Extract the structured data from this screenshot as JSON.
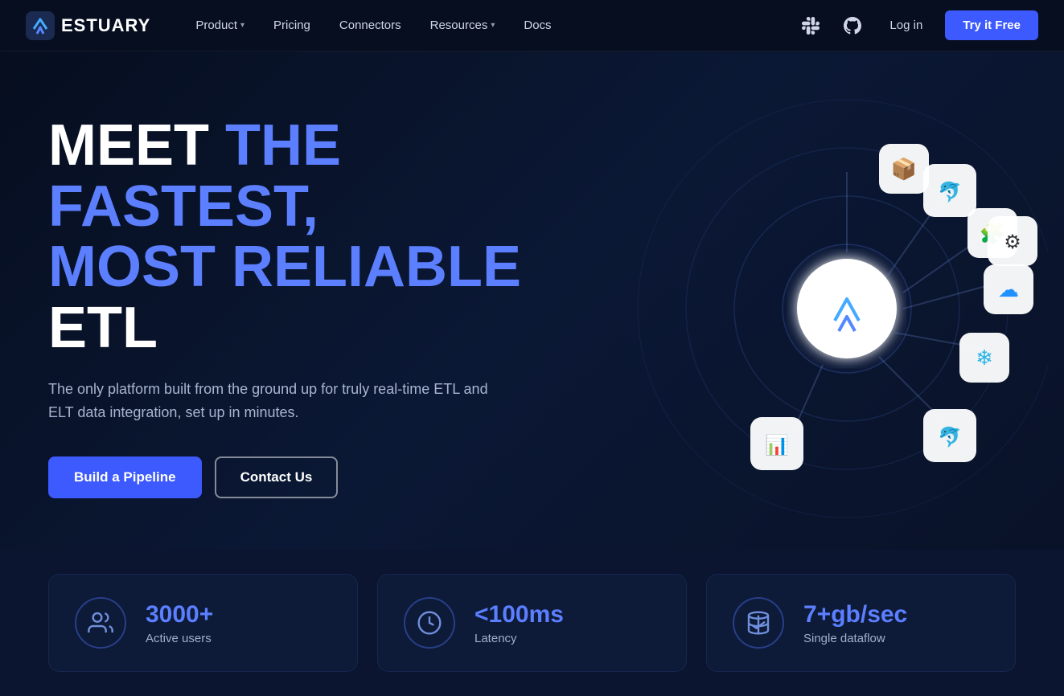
{
  "logo": {
    "text": "ESTUARY"
  },
  "nav": {
    "links": [
      {
        "label": "Product",
        "hasDropdown": true,
        "id": "product"
      },
      {
        "label": "Pricing",
        "hasDropdown": false,
        "id": "pricing"
      },
      {
        "label": "Connectors",
        "hasDropdown": false,
        "id": "connectors"
      },
      {
        "label": "Resources",
        "hasDropdown": true,
        "id": "resources"
      },
      {
        "label": "Docs",
        "hasDropdown": false,
        "id": "docs"
      }
    ],
    "login_label": "Log in",
    "try_free_label": "Try it Free"
  },
  "hero": {
    "heading_white1": "MEET ",
    "heading_blue1": "THE FASTEST,",
    "heading_newline": "",
    "heading_blue2": "MOST RELIABLE ",
    "heading_white2": "ETL",
    "subtext": "The only platform built from the ground up for truly real-time ETL and ELT data integration, set up in minutes.",
    "btn_primary": "Build a Pipeline",
    "btn_outline": "Contact Us"
  },
  "stats": [
    {
      "id": "users",
      "icon": "users-icon",
      "value": "3000+",
      "label": "Active users"
    },
    {
      "id": "latency",
      "icon": "clock-icon",
      "value": "<100ms",
      "label": "Latency"
    },
    {
      "id": "dataflow",
      "icon": "database-icon",
      "value": "7+gb/sec",
      "label": "Single dataflow"
    }
  ],
  "connectors": [
    {
      "color": "#e04040",
      "shape": "puzzle",
      "pos": "top-right"
    },
    {
      "color": "#4488ff",
      "shape": "cloud",
      "pos": "right-top"
    },
    {
      "color": "#ff8800",
      "shape": "circle-dots",
      "pos": "right-mid"
    },
    {
      "color": "#00aaff",
      "shape": "snowflake",
      "pos": "bottom-mid"
    },
    {
      "color": "#22bb44",
      "shape": "stripe",
      "pos": "bottom-left"
    }
  ]
}
